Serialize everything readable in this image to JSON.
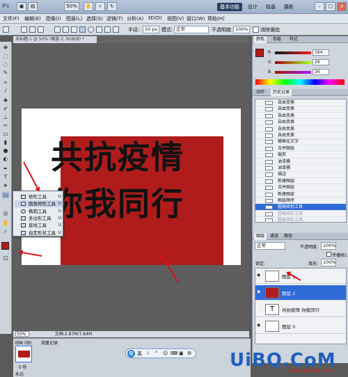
{
  "titlebar": {
    "app": "Ps",
    "zoom": "50%",
    "workspaces": [
      "基本功能",
      "设计",
      "绘画",
      "摄影"
    ],
    "active_workspace": "基本功能"
  },
  "menu": [
    "文件(F)",
    "编辑(E)",
    "图像(I)",
    "图层(L)",
    "选择(S)",
    "滤镜(T)",
    "分析(A)",
    "3D(D)",
    "视图(V)",
    "窗口(W)",
    "帮助(H)"
  ],
  "options": {
    "radius_label": "半径:",
    "radius_value": "10 px",
    "mode_label": "模式:",
    "mode_value": "正常",
    "opacity_label": "不透明度:",
    "opacity_value": "100%",
    "antialias_label": "消除锯齿"
  },
  "document": {
    "tab_title": "未标题-1 @ 50% (图层 2, RGB/8) *",
    "zoom": "50%",
    "doc_info": "文档:2.87M/7.64M",
    "text_line1": "共抗疫情",
    "text_line2": "你我同行"
  },
  "tool_flyout": [
    {
      "label": "矩形工具",
      "key": "U"
    },
    {
      "label": "圆角矩形工具",
      "key": "U"
    },
    {
      "label": "椭圆工具",
      "key": "U"
    },
    {
      "label": "多边形工具",
      "key": "U"
    },
    {
      "label": "直线工具",
      "key": "U"
    },
    {
      "label": "自定形状工具",
      "key": "U"
    }
  ],
  "color_panel": {
    "r_label": "R",
    "r": "164",
    "g_label": "G",
    "g": "26",
    "b_label": "B",
    "b": "26"
  },
  "history_tabs": [
    "动作",
    "历史记录"
  ],
  "history": [
    "自由变换",
    "自由变换",
    "自由变换",
    "自由变换",
    "自由变换",
    "自由变换",
    "栅格化文字",
    "合并图层",
    "裁剪",
    "油漆桶",
    "油漆桶",
    "描边",
    "新建图层",
    "合并图层",
    "新建图层",
    "图层顺序",
    "圆角矩形工具",
    "圆角矩形工具",
    "圆角矩形工具"
  ],
  "history_selected_index": 16,
  "layers_tabs": [
    "图层",
    "通道",
    "路径"
  ],
  "layers_options": {
    "blend": "正常",
    "opacity_label": "不透明度:",
    "opacity": "100%",
    "lock_label": "锁定:",
    "fill_label": "填充:",
    "fill": "100%",
    "group_label": "传播帧1"
  },
  "layers": [
    {
      "name": "图层 1",
      "selected": false
    },
    {
      "name": "图层 2",
      "selected": true
    },
    {
      "name": "共抗疫情 你我同行",
      "selected": false
    },
    {
      "name": "图层 0",
      "selected": false
    }
  ],
  "bottom_panel": {
    "tab1": "动画 (帧)",
    "tab2": "测量记录",
    "frame_time": "0 秒",
    "loop": "永远"
  },
  "ime": {
    "logo": "Q",
    "lang": "英"
  },
  "watermark": {
    "main": "UiBQ.CoM",
    "sub": "www.psanz.com"
  },
  "colors": {
    "fg": "#b01c1c",
    "accent": "#2f6bd6"
  }
}
